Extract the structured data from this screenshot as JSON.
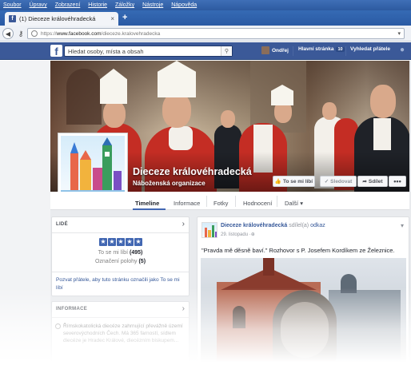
{
  "menubar": {
    "items": [
      "Soubor",
      "Úpravy",
      "Zobrazení",
      "Historie",
      "Záložky",
      "Nástroje",
      "Nápověda"
    ]
  },
  "browser": {
    "tab_title": "(1) Dieceze královéhradecká",
    "new_tab": "+",
    "url_scheme": "https://",
    "url_host": "www.facebook.com",
    "url_path": "/dieceze.kralovehradecka",
    "url_full": "https://www.facebook.com/dieceze.kralovehradecka"
  },
  "fb": {
    "search_placeholder": "Hledat osoby, místa a obsah",
    "user_name": "Ondřej",
    "home_label": "Hlavní stránka",
    "home_count": "10",
    "find_friends": "Vyhledat přátele"
  },
  "page": {
    "title": "Dieceze královéhradecká",
    "category": "Náboženská organizace",
    "like_button": "To se mi líbí",
    "follow_button": "Sledovat",
    "share_button": "Sdílet",
    "more_button": "•••",
    "tabs": [
      "Timeline",
      "Informace",
      "Fotky",
      "Hodnocení",
      "Další"
    ]
  },
  "people_card": {
    "heading": "LIDÉ",
    "rating": 5,
    "likes_label": "To se mi líbí",
    "likes_count": "(495)",
    "mentions_label": "Označení polohy",
    "mentions_count": "(5)",
    "invite_text": "Pozvat přátele, aby tuto stránku označili jako To se mi líbí"
  },
  "info_card": {
    "heading": "INFORMACE",
    "text": "Římskokatolická diecéze zahrnující převážně území severovýchodních Čech. Má 365 farností, sídlem diecéze je Hradec Králové, diecézním biskupem..."
  },
  "post": {
    "author": "Dieceze královéhradecká",
    "verb": "sdílel(a)",
    "link": "odkaz",
    "date": "29. listopadu",
    "text": "\"Pravda mě děsně baví.\" Rozhovor s P. Josefem Kordíkem ze Železnice."
  },
  "colors": {
    "menubar": "#2d5aa0",
    "facebook_blue": "#3b5998",
    "link_blue": "#365899",
    "star_blue": "#4267b2",
    "page_bg": "#e9ebee"
  },
  "icons": {
    "back": "arrow-left-icon",
    "search": "magnifier-icon",
    "like": "thumb-up-icon",
    "share": "share-arrow-icon",
    "friends": "people-icon",
    "public": "globe-icon"
  }
}
